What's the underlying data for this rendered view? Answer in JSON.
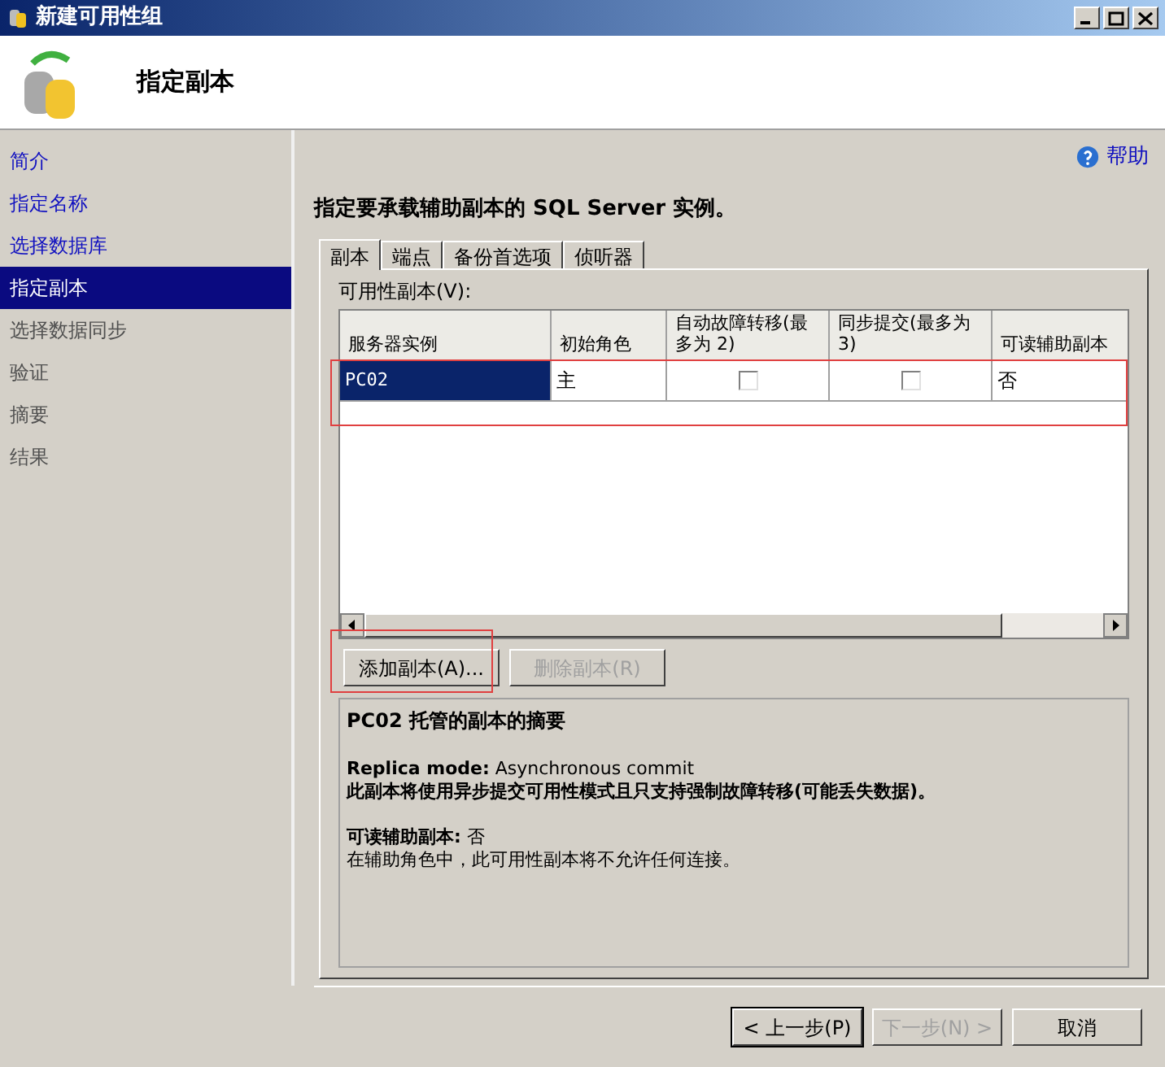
{
  "window": {
    "title": "新建可用性组"
  },
  "header": {
    "title": "指定副本"
  },
  "sidebar": {
    "items": [
      {
        "label": "简介",
        "selected": false,
        "disabled": false
      },
      {
        "label": "指定名称",
        "selected": false,
        "disabled": false
      },
      {
        "label": "选择数据库",
        "selected": false,
        "disabled": false
      },
      {
        "label": "指定副本",
        "selected": true,
        "disabled": false
      },
      {
        "label": "选择数据同步",
        "selected": false,
        "disabled": true
      },
      {
        "label": "验证",
        "selected": false,
        "disabled": true
      },
      {
        "label": "摘要",
        "selected": false,
        "disabled": true
      },
      {
        "label": "结果",
        "selected": false,
        "disabled": true
      }
    ]
  },
  "help": "帮助",
  "instruction": "指定要承载辅助副本的 SQL Server 实例。",
  "tabs": [
    {
      "label": "副本",
      "selected": true
    },
    {
      "label": "端点",
      "selected": false
    },
    {
      "label": "备份首选项",
      "selected": false
    },
    {
      "label": "侦听器",
      "selected": false
    }
  ],
  "table": {
    "label": "可用性副本(V):",
    "columns": [
      "服务器实例",
      "初始角色",
      "自动故障转移(最多为 2)",
      "同步提交(最多为 3)",
      "可读辅助副本"
    ],
    "rows": [
      {
        "server": "PC02",
        "role": "主",
        "auto_failover": false,
        "sync_commit": false,
        "readable": "否",
        "selected": true,
        "highlighted": true
      }
    ]
  },
  "buttons": [
    {
      "label": "添加副本(A)...",
      "disabled": false,
      "highlighted": true
    },
    {
      "label": "删除副本(R)",
      "disabled": true,
      "highlighted": false
    }
  ],
  "summary": {
    "title": "PC02 托管的副本的摘要",
    "groups": [
      [
        "**Replica mode:** Asynchronous commit",
        "**此副本将使用异步提交可用性模式且只支持强制故障转移(可能丢失数据)。**"
      ],
      [
        "**可读辅助副本:** 否",
        "在辅助角色中，此可用性副本将不允许任何连接。"
      ]
    ]
  },
  "footer": [
    {
      "label": "< 上一步(P)",
      "disabled": false,
      "default": true
    },
    {
      "label": "下一步(N) >",
      "disabled": true,
      "default": false
    },
    {
      "label": "取消",
      "disabled": false,
      "default": false
    }
  ]
}
